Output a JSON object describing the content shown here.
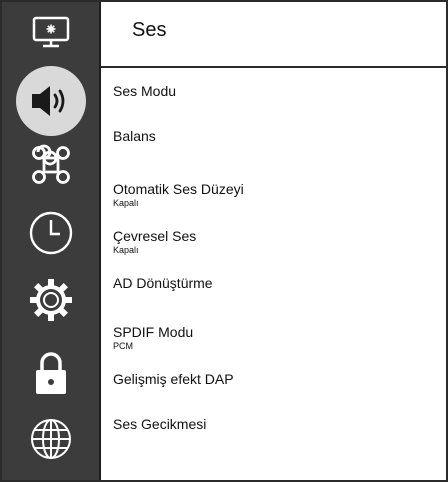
{
  "header": {
    "title": "Ses"
  },
  "sidebar": {
    "items": [
      {
        "icon": "tv-settings-icon"
      },
      {
        "icon": "speaker-icon",
        "selected": true
      },
      {
        "icon": "command-icon"
      },
      {
        "icon": "clock-icon"
      },
      {
        "icon": "gear-icon"
      },
      {
        "icon": "lock-icon"
      },
      {
        "icon": "globe-icon"
      }
    ]
  },
  "menu": {
    "items": [
      {
        "label": "Ses Modu"
      },
      {
        "label": "Balans"
      },
      {
        "label": "Otomatik Ses Düzeyi",
        "value": "Kapalı"
      },
      {
        "label": "Çevresel Ses",
        "value": "Kapalı"
      },
      {
        "label": "AD Dönüştürme"
      },
      {
        "label": "SPDIF Modu",
        "value": "PCM"
      },
      {
        "label": "Gelişmiş efekt DAP"
      },
      {
        "label": "Ses Gecikmesi"
      }
    ]
  },
  "colors": {
    "sidebar_bg": "#3c3c3c",
    "selected_bg": "#d9d9d9",
    "icon_fill": "#ffffff",
    "text": "#111111"
  }
}
